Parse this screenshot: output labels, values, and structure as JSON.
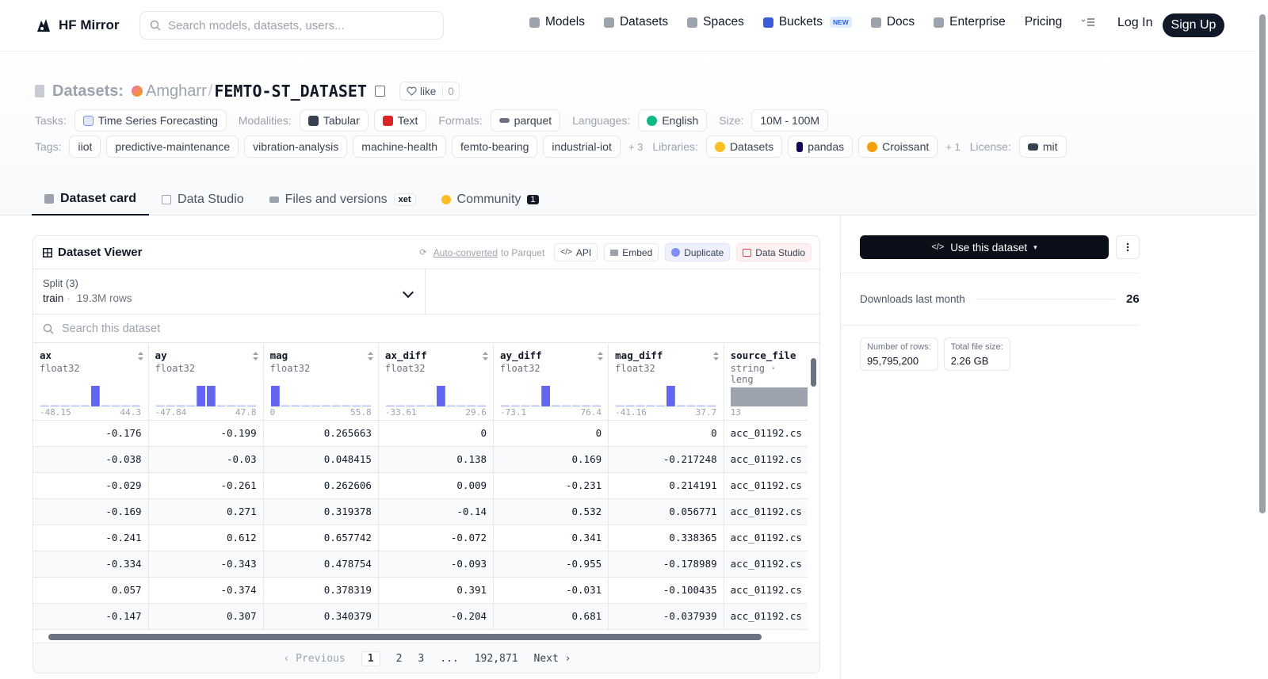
{
  "nav": {
    "brand": "HF Mirror",
    "search_placeholder": "Search models, datasets, users...",
    "links": [
      "Models",
      "Datasets",
      "Spaces",
      "Buckets",
      "Docs",
      "Enterprise",
      "Pricing"
    ],
    "new_badge": "NEW",
    "login": "Log In",
    "signup": "Sign Up"
  },
  "repo": {
    "type_label": "Datasets:",
    "owner": "Amgharr",
    "sep": "/",
    "name": "FEMTO-ST_DATASET",
    "like_label": "like",
    "like_count": "0"
  },
  "meta": {
    "tasks_label": "Tasks:",
    "task": "Time Series Forecasting",
    "modalities_label": "Modalities:",
    "modalities": [
      "Tabular",
      "Text"
    ],
    "formats_label": "Formats:",
    "format": "parquet",
    "languages_label": "Languages:",
    "language": "English",
    "size_label": "Size:",
    "size": "10M - 100M",
    "tags_label": "Tags:",
    "tags": [
      "iiot",
      "predictive-maintenance",
      "vibration-analysis",
      "machine-health",
      "femto-bearing",
      "industrial-iot"
    ],
    "tags_more": "+ 3",
    "libraries_label": "Libraries:",
    "libraries": [
      "Datasets",
      "pandas",
      "Croissant"
    ],
    "libraries_more": "+ 1",
    "license_label": "License:",
    "license": "mit"
  },
  "tabs": [
    {
      "label": "Dataset card"
    },
    {
      "label": "Data Studio"
    },
    {
      "label": "Files and versions",
      "badge": "xet"
    },
    {
      "label": "Community",
      "badge": "1"
    }
  ],
  "viewer": {
    "title": "Dataset Viewer",
    "auto_converted": "Auto-converted",
    "to_parquet": "to Parquet",
    "api": "API",
    "embed": "Embed",
    "duplicate": "Duplicate",
    "data_studio": "Data Studio",
    "split_label": "Split (3)",
    "split_name": "train",
    "split_rows": "19.3M rows",
    "search_placeholder": "Search this dataset",
    "columns": [
      {
        "name": "ax",
        "type": "float32",
        "min": "-48.15",
        "max": "44.3",
        "hist": [
          0.05,
          0.05,
          0.05,
          0.05,
          0.05,
          1,
          0.05,
          0.05,
          0.05,
          0.05
        ]
      },
      {
        "name": "ay",
        "type": "float32",
        "min": "-47.84",
        "max": "47.8",
        "hist": [
          0.05,
          0.05,
          0.05,
          0.05,
          1,
          1,
          0.05,
          0.05,
          0.05,
          0.05
        ]
      },
      {
        "name": "mag",
        "type": "float32",
        "min": "0",
        "max": "55.8",
        "hist": [
          1,
          0.05,
          0.05,
          0.05,
          0.05,
          0.05,
          0.05,
          0.05,
          0.05,
          0.05
        ]
      },
      {
        "name": "ax_diff",
        "type": "float32",
        "min": "-33.61",
        "max": "29.6",
        "hist": [
          0.05,
          0.05,
          0.05,
          0.05,
          0.05,
          1,
          0.05,
          0.05,
          0.05,
          0.05
        ]
      },
      {
        "name": "ay_diff",
        "type": "float32",
        "min": "-73.1",
        "max": "76.4",
        "hist": [
          0.05,
          0.05,
          0.05,
          0.05,
          1,
          0.05,
          0.05,
          0.05,
          0.05,
          0.05
        ]
      },
      {
        "name": "mag_diff",
        "type": "float32",
        "min": "-41.16",
        "max": "37.7",
        "hist": [
          0.05,
          0.05,
          0.05,
          0.05,
          0.05,
          1,
          0.05,
          0.05,
          0.05,
          0.05
        ]
      },
      {
        "name": "source_file",
        "type": "string · leng",
        "min": "13",
        "max": "",
        "hist": []
      }
    ],
    "rows": [
      [
        "-0.176",
        "-0.199",
        "0.265663",
        "0",
        "0",
        "0",
        "acc_01192.cs"
      ],
      [
        "-0.038",
        "-0.03",
        "0.048415",
        "0.138",
        "0.169",
        "-0.217248",
        "acc_01192.cs"
      ],
      [
        "-0.029",
        "-0.261",
        "0.262606",
        "0.009",
        "-0.231",
        "0.214191",
        "acc_01192.cs"
      ],
      [
        "-0.169",
        "0.271",
        "0.319378",
        "-0.14",
        "0.532",
        "0.056771",
        "acc_01192.cs"
      ],
      [
        "-0.241",
        "0.612",
        "0.657742",
        "-0.072",
        "0.341",
        "0.338365",
        "acc_01192.cs"
      ],
      [
        "-0.334",
        "-0.343",
        "0.478754",
        "-0.093",
        "-0.955",
        "-0.178989",
        "acc_01192.cs"
      ],
      [
        "0.057",
        "-0.374",
        "0.378319",
        "0.391",
        "-0.031",
        "-0.100435",
        "acc_01192.cs"
      ],
      [
        "-0.147",
        "0.307",
        "0.340379",
        "-0.204",
        "0.681",
        "-0.037939",
        "acc_01192.cs"
      ]
    ],
    "pager": {
      "previous": "Previous",
      "pages": [
        "1",
        "2",
        "3",
        "..."
      ],
      "last": "192,871",
      "next": "Next"
    }
  },
  "sidebar": {
    "use_dataset": "Use this dataset",
    "downloads_label": "Downloads last month",
    "downloads": "26",
    "num_rows_label": "Number of rows:",
    "num_rows": "95,795,200",
    "file_size_label": "Total file size:",
    "file_size": "2.26 GB"
  },
  "colors": {
    "accent": "#6366f1",
    "dark": "#111827",
    "muted": "#9ca3af"
  }
}
